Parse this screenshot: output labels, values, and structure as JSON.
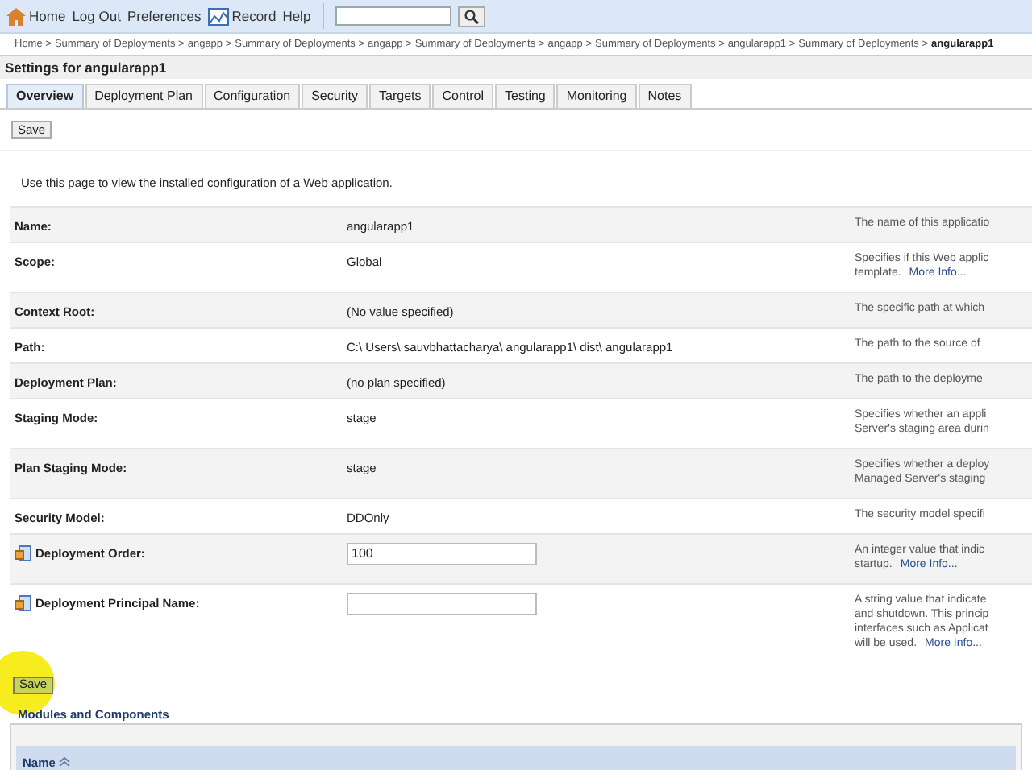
{
  "toolbar": {
    "items": [
      {
        "label": "Home"
      },
      {
        "label": "Log Out"
      },
      {
        "label": "Preferences"
      },
      {
        "label": "Record"
      },
      {
        "label": "Help"
      }
    ]
  },
  "breadcrumb": [
    "Home >",
    "Summary of Deployments >",
    "angapp >",
    "Summary of Deployments >",
    "angapp >",
    "Summary of Deployments >",
    "angapp >",
    "Summary of Deployments >",
    "angularapp1 >",
    "Summary of Deployments >",
    "angularapp1"
  ],
  "title": "Settings for angularapp1",
  "tabs": [
    {
      "label": "Overview",
      "selected": true
    },
    {
      "label": "Deployment Plan",
      "selected": false
    },
    {
      "label": "Configuration",
      "selected": false
    },
    {
      "label": "Security",
      "selected": false
    },
    {
      "label": "Targets",
      "selected": false
    },
    {
      "label": "Control",
      "selected": false
    },
    {
      "label": "Testing",
      "selected": false
    },
    {
      "label": "Monitoring",
      "selected": false
    },
    {
      "label": "Notes",
      "selected": false
    }
  ],
  "save_button": "Save",
  "intro": "Use this page to view the installed configuration of a Web application.",
  "fields": [
    {
      "kind": "text",
      "label": "Name:",
      "value": "angularapp1",
      "description": [
        "The name of this applicatio"
      ]
    },
    {
      "kind": "text",
      "label": "Scope:",
      "value": "Global",
      "description": [
        "Specifies if this Web applic",
        "template."
      ],
      "more_info": "More Info..."
    },
    {
      "kind": "text",
      "label": "Context Root:",
      "value": "(No value specified)",
      "description": [
        "The specific path at which"
      ]
    },
    {
      "kind": "text",
      "label": "Path:",
      "value": "C:\\ Users\\ sauvbhattacharya\\ angularapp1\\ dist\\ angularapp1",
      "description": [
        "The path to the source of"
      ]
    },
    {
      "kind": "text",
      "label": "Deployment Plan:",
      "value": "(no plan specified)",
      "description": [
        "The path to the deployme"
      ]
    },
    {
      "kind": "text",
      "label": "Staging Mode:",
      "value": "stage",
      "description": [
        "Specifies whether an appli",
        "Server's staging area durin"
      ]
    },
    {
      "kind": "text",
      "label": "Plan Staging Mode:",
      "value": "stage",
      "description": [
        "Specifies whether a deploy",
        "Managed Server's staging"
      ]
    },
    {
      "kind": "text",
      "label": "Security Model:",
      "value": "DDOnly",
      "description": [
        "The security model specifi"
      ]
    },
    {
      "kind": "input",
      "label": "Deployment Order:",
      "value": "100",
      "description": [
        "An integer value that indic",
        "startup."
      ],
      "more_info": "More Info..."
    },
    {
      "kind": "input",
      "label": "Deployment Principal Name:",
      "description": [
        "A string value that indicate",
        "and shutdown. This princip",
        "interfaces such as Applicat",
        "will be used."
      ],
      "more_info": "More Info..."
    }
  ],
  "save_button_bottom": "Save",
  "modules": {
    "title": "Modules and Components",
    "columns": [
      "Name"
    ]
  }
}
